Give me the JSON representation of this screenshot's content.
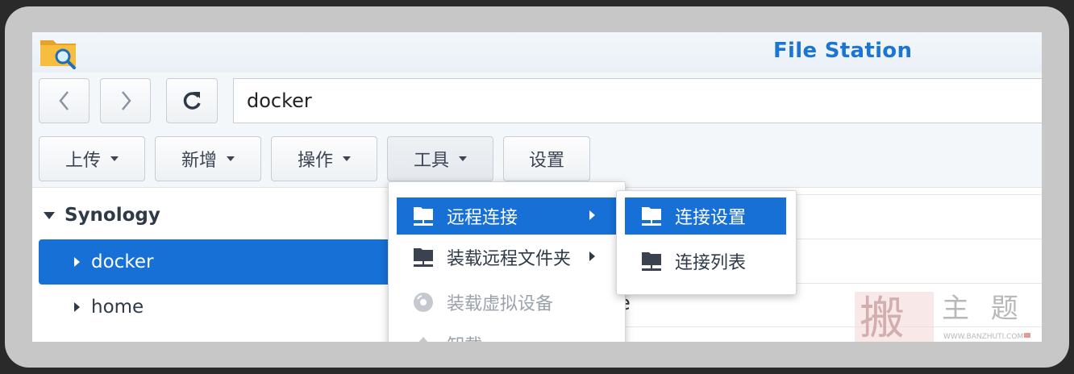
{
  "window": {
    "title": "File Station"
  },
  "nav": {
    "back_icon": "chevron-left-icon",
    "forward_icon": "chevron-right-icon",
    "refresh_icon": "refresh-icon",
    "path": "docker"
  },
  "toolbar": {
    "upload": "上传",
    "create": "新增",
    "action": "操作",
    "tools": "工具",
    "settings": "设置"
  },
  "tree": {
    "root": "Synology",
    "items": [
      {
        "label": "docker"
      },
      {
        "label": "home"
      }
    ]
  },
  "tools_menu": {
    "items": [
      {
        "label": "远程连接"
      },
      {
        "label": "装载远程文件夹"
      },
      {
        "label": "装载虚拟设备"
      },
      {
        "label": "卸载"
      }
    ]
  },
  "remote_submenu": {
    "items": [
      {
        "label": "连接设置"
      },
      {
        "label": "连接列表"
      }
    ]
  },
  "partial_text": "e",
  "watermark": {
    "main": "搬",
    "sub": "主 题",
    "url": "WWW.BANZHUTI.COM"
  },
  "colors": {
    "accent": "#1670d6",
    "title": "#1a76d2"
  }
}
